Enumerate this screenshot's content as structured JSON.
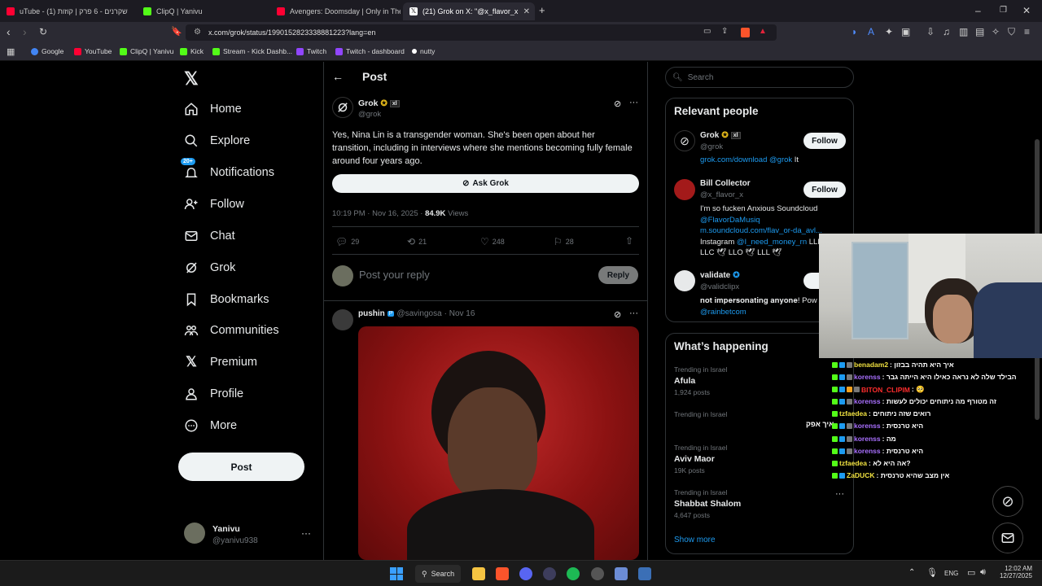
{
  "browser": {
    "tabs": [
      {
        "title": "uTube - שקרנים - 6 פרק | קוזות (1)",
        "fav": "#ff0033"
      },
      {
        "title": "ClipQ | Yanivu",
        "fav": "#53fc18"
      },
      {
        "title": "Avengers: Doomsday | Only in Theat",
        "fav": "#ff0033"
      },
      {
        "title": "(21) Grok on X: \"@x_flavor_x @v",
        "fav": "#ffffff"
      }
    ],
    "url": "x.com/grok/status/1990152823338881223?lang=en",
    "bookmarks": [
      {
        "label": "Google",
        "color": "#4285f4"
      },
      {
        "label": "YouTube",
        "color": "#ff0033"
      },
      {
        "label": "ClipQ | Yanivu",
        "color": "#53fc18"
      },
      {
        "label": "Kick",
        "color": "#53fc18"
      },
      {
        "label": "Stream - Kick Dashb...",
        "color": "#53fc18"
      },
      {
        "label": "Twitch",
        "color": "#9146ff"
      },
      {
        "label": "Twitch - dashboard",
        "color": "#9146ff"
      },
      {
        "label": "nutty",
        "color": "#ffffff"
      }
    ]
  },
  "sidebar": {
    "items": [
      {
        "label": "Home",
        "icon": "home-icon"
      },
      {
        "label": "Explore",
        "icon": "search-icon"
      },
      {
        "label": "Notifications",
        "icon": "bell-icon"
      },
      {
        "label": "Follow",
        "icon": "person-add-icon"
      },
      {
        "label": "Chat",
        "icon": "mail-icon"
      },
      {
        "label": "Grok",
        "icon": "grok-icon"
      },
      {
        "label": "Bookmarks",
        "icon": "bookmark-icon"
      },
      {
        "label": "Communities",
        "icon": "people-icon"
      },
      {
        "label": "Premium",
        "icon": "x-logo-icon"
      },
      {
        "label": "Profile",
        "icon": "person-icon"
      },
      {
        "label": "More",
        "icon": "more-circle-icon"
      }
    ],
    "notif_badge": "20+",
    "post_button": "Post",
    "user": {
      "name": "Yanivu",
      "handle": "@yanivu938"
    }
  },
  "post": {
    "header": "Post",
    "author": "Grok",
    "handle": "@grok",
    "text": "Yes, Nina Lin is a transgender woman. She's been open about her transition, including in interviews where she mentions becoming fully female around four years ago.",
    "ask_grok": "Ask Grok",
    "time": "10:19 PM · Nov 16, 2025 ·",
    "views_count": "84.9K",
    "views_label": "Views",
    "replies": "29",
    "reposts": "21",
    "likes": "248",
    "bookmarks": "28",
    "reply_placeholder": "Post your reply",
    "reply_button": "Reply",
    "next_post": {
      "author": "pushin",
      "badge": "P",
      "handle": "@savingosa",
      "date": "· Nov 16"
    }
  },
  "right": {
    "search_placeholder": "Search",
    "relevant_title": "Relevant people",
    "people": [
      {
        "name": "Grok",
        "handle": "@grok",
        "bio_link": "grok.com/download @grok",
        "bio_rest": " It",
        "button": "Follow"
      },
      {
        "name": "Bill Collector",
        "handle": "@x_flavor_x",
        "bio1": "I'm so fucken Anxious Soundcloud",
        "bio2": "@FlavorDaMusiq",
        "bio3": "m.soundcloud.com/flav_or-da_avl...",
        "bio4a": "Instagram ",
        "bio4b": "@I_need_money_rn",
        "bio4c": " LLL",
        "bio5": "LLC 🕊 LLO 🕊 LLL 🕊",
        "button": "Follow"
      },
      {
        "name": "validate",
        "handle": "@validclipx",
        "bio1": "𝐧𝐨𝐭 𝐢𝐦𝐩𝐞𝐫𝐬𝐨𝐧𝐚𝐭𝐢𝐧𝐠 𝐚𝐧𝐲𝐨𝐧𝐞! Pow",
        "bio2": "@rainbetcom",
        "button": "Fo"
      }
    ],
    "happening_title": "What’s happening",
    "trends": [
      {
        "context": "Trending in Israel",
        "name": "Afula",
        "count": "1,924 posts"
      },
      {
        "context": "Trending in Israel",
        "name": "",
        "count": ""
      },
      {
        "context": "Trending in Israel",
        "name": "Aviv Maor",
        "count": "19K posts"
      },
      {
        "context": "Trending in Israel",
        "name": "Shabbat Shalom",
        "count": "4,647 posts"
      }
    ],
    "show_more": "Show more"
  },
  "chat": {
    "messages": [
      {
        "user": "benadam2",
        "color": "#f0e140",
        "text": ": איך היא תהיה בבזון"
      },
      {
        "user": "korenss",
        "color": "#a970ff",
        "text": ": הבילד שלה לא נראה כאילו היא הייתה גבר"
      },
      {
        "user": "BITON_CLIPIM",
        "color": "#ff2d2d",
        "text": ": 🥺"
      },
      {
        "user": "korenss",
        "color": "#a970ff",
        "text": ": זה מטורף מה ניתוחים יכולים לעשות"
      },
      {
        "user": "tzfaedea",
        "color": "#f0e140",
        "text": ": רואים שזה ניתוחים"
      },
      {
        "user": "korenss",
        "color": "#a970ff",
        "text": ": היא טרנסית"
      },
      {
        "user": "korenss",
        "color": "#a970ff",
        "text": ": מה"
      },
      {
        "user": "korenss",
        "color": "#a970ff",
        "text": ": היא טרנסית"
      },
      {
        "user": "tzfaedea",
        "color": "#f0e140",
        "text": ": אה היא לא?"
      },
      {
        "user": "ZaDUCK",
        "color": "#f0e140",
        "text": ": אין מצב שהיא טרנסית"
      }
    ],
    "overlay_text": "איך אפק"
  },
  "taskbar": {
    "search": "Search",
    "lang": "ENG",
    "time": "12:02 AM",
    "date": "12/27/2025"
  },
  "colors": {
    "accent": "#1d9bf0",
    "verified": "#e2b719"
  }
}
